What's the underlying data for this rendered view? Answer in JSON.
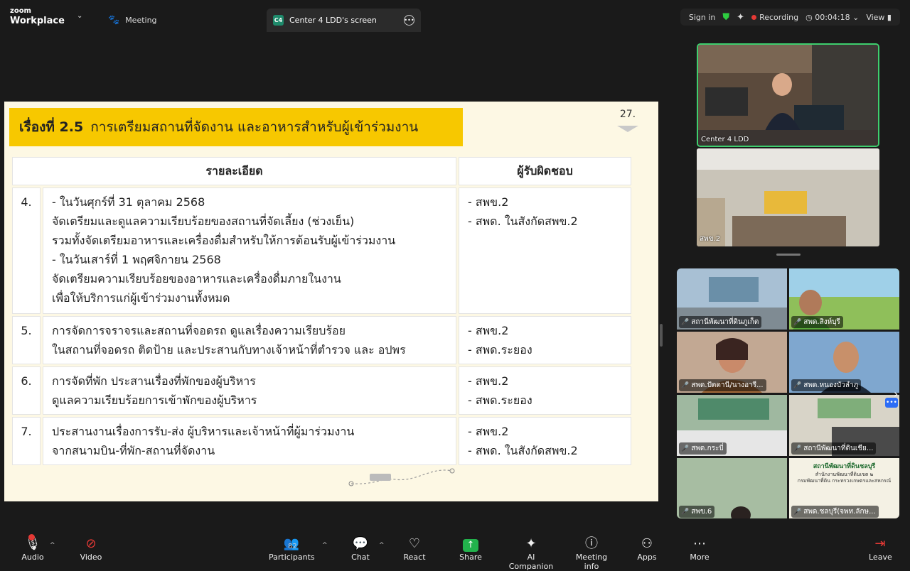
{
  "topbar": {
    "logo_line1": "zoom",
    "logo_line2": "Workplace",
    "meeting_label": "Meeting",
    "screen_tab_badge": "C4",
    "screen_tab_label": "Center 4 LDD's screen",
    "sign_in": "Sign in",
    "recording_label": "Recording",
    "timer": "00:04:18",
    "view_label": "View"
  },
  "slide": {
    "page_number": "27.",
    "title_prefix": "เรื่องที่ 2.5",
    "title_text": "การเตรียมสถานที่จัดงาน และอาหารสำหรับผู้เข้าร่วมงาน",
    "col_detail": "รายละเอียด",
    "col_responsible": "ผู้รับผิดชอบ",
    "rows": [
      {
        "num": "4.",
        "detail": [
          "- ในวันศุกร์ที่ 31 ตุลาคม 2568",
          "จัดเตรียมและดูแลความเรียบร้อยของสถานที่จัดเลี้ยง (ช่วงเย็น)",
          "รวมทั้งจัดเตรียมอาหารและเครื่องดื่มสำหรับให้การต้อนรับผู้เข้าร่วมงาน",
          "- ในวันเสาร์ที่ 1 พฤศจิกายน 2568",
          "จัดเตรียมความเรียบร้อยของอาหารและเครื่องดื่มภายในงาน",
          "เพื่อให้บริการแก่ผู้เข้าร่วมงานทั้งหมด"
        ],
        "responsible": [
          "- สพข.2",
          "- สพด. ในสังกัดสพข.2"
        ]
      },
      {
        "num": "5.",
        "detail": [
          "การจัดการจราจรและสถานที่จอดรถ ดูแลเรื่องความเรียบร้อย",
          "ในสถานที่จอดรถ ติดป้าย และประสานกับทางเจ้าหน้าที่ตำรวจ และ อปพร"
        ],
        "responsible": [
          "- สพข.2",
          "- สพด.ระยอง"
        ]
      },
      {
        "num": "6.",
        "detail": [
          "การจัดที่พัก ประสานเรื่องที่พักของผู้บริหาร",
          "ดูแลความเรียบร้อยการเข้าพักของผู้บริหาร"
        ],
        "responsible": [
          "- สพข.2",
          "- สพด.ระยอง"
        ]
      },
      {
        "num": "7.",
        "detail": [
          "ประสานงานเรื่องการรับ-ส่ง ผู้บริหารและเจ้าหน้าที่ผู้มาร่วมงาน",
          "จากสนามบิน-ที่พัก-สถานที่จัดงาน"
        ],
        "responsible": [
          "- สพข.2",
          "- สพด. ในสังกัดสพข.2"
        ]
      }
    ]
  },
  "panes": {
    "active_speaker": "Center 4 LDD",
    "second": "สพข.2"
  },
  "gallery": [
    "สถานีพัฒนาที่ดินภูเก็ต",
    "สพด.สิงห์บุรี",
    "สพด.ปัตตานี/นางอารี...",
    "สพด.หนองบัวลำภู",
    "สพด.กระบี่",
    "สถานีพัฒนาที่ดินเชีย...",
    "สพข.6",
    "สพด.ชลบุรี(จพท.ลักษ..."
  ],
  "gallery_poster": {
    "line1": "สถานีพัฒนาที่ดินชลบุรี",
    "line2": "สำนักงานพัฒนาที่ดินเขต ๒",
    "line3": "กรมพัฒนาที่ดิน กระทรวงเกษตรและสหกรณ์"
  },
  "toolbar": {
    "audio": "Audio",
    "video": "Video",
    "participants": "Participants",
    "participants_count": "82",
    "chat": "Chat",
    "react": "React",
    "share": "Share",
    "ai_companion": "AI Companion",
    "meeting_info": "Meeting info",
    "apps": "Apps",
    "more": "More",
    "leave": "Leave"
  },
  "colors": {
    "title_bar": "#f7c800",
    "slide_bg": "#fdf8e4",
    "active_border": "#3ecf6e",
    "share_green": "#22b24c",
    "recording_red": "#e53935"
  }
}
